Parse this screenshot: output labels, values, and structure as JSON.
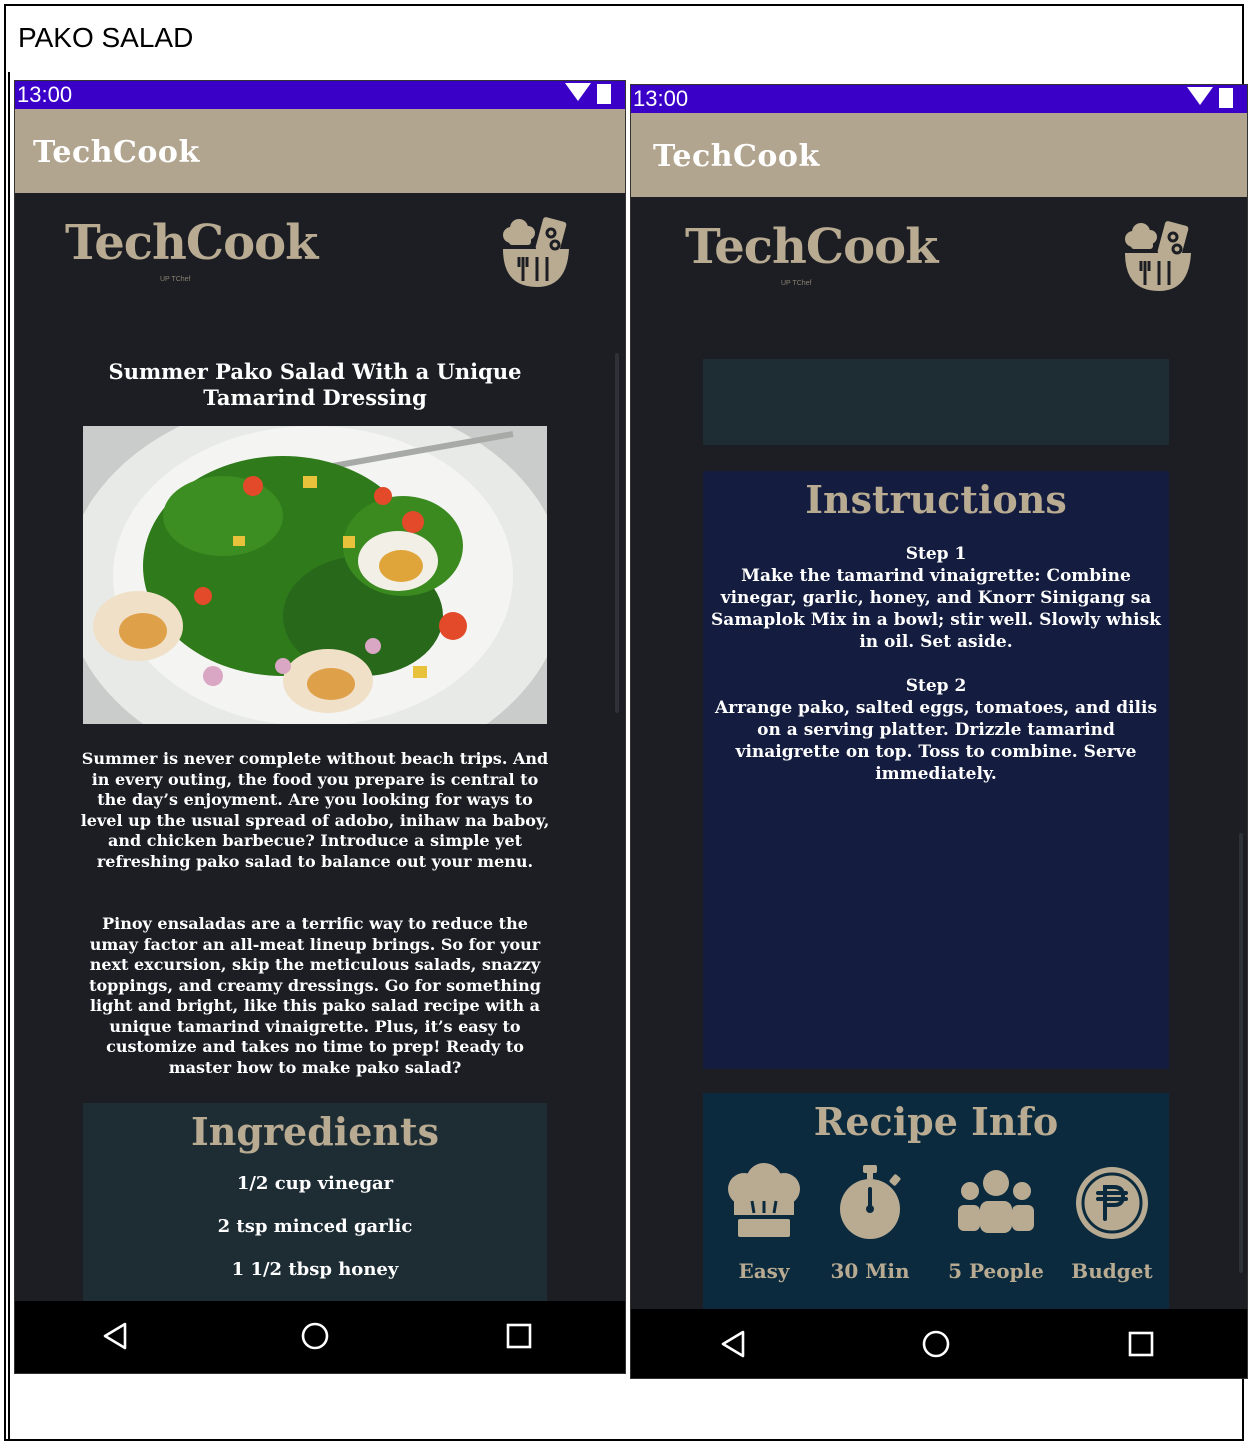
{
  "outer_title": "PAKO SALAD",
  "colors": {
    "status_bar": "#3b00c8",
    "app_bar": "#b2a58f",
    "background": "#1c1e24",
    "accent_tan": "#b8ab92",
    "ingredients_box": "#1e2c34",
    "instructions_box": "#141d3f",
    "info_box": "#0b2a3e"
  },
  "status_bar": {
    "time": "13:00",
    "icons": [
      "signal-icon",
      "battery-icon"
    ]
  },
  "app_bar": {
    "title": "TechCook"
  },
  "logo": {
    "text": "TechCook",
    "sub": "UP TChef",
    "icon": "chef-utensils-icon"
  },
  "screen1": {
    "recipe_title": "Summer Pako Salad With a Unique Tamarind Dressing",
    "description_1": "Summer is never complete without beach trips. And in every outing, the food you prepare is central to the day’s enjoyment. Are you looking for ways to level up the usual spread of adobo, inihaw na baboy, and chicken barbecue? Introduce a simple yet refreshing pako salad to balance out your menu.",
    "description_2": "Pinoy ensaladas are a terrific way to reduce the umay factor an all-meat lineup brings. So for your next excursion, skip the meticulous salads, snazzy toppings, and creamy dressings. Go for something light and bright, like this pako salad recipe with a unique tamarind vinaigrette. Plus, it’s easy to customize and takes no time to prep! Ready to master how to make pako salad?",
    "ingredients": {
      "heading": "Ingredients",
      "items": [
        "1/2 cup vinegar",
        "2 tsp minced garlic",
        "1 1/2 tbsp honey"
      ]
    }
  },
  "screen2": {
    "instructions": {
      "heading": "Instructions",
      "steps": [
        {
          "label": "Step 1",
          "text": "Make the tamarind vinaigrette: Combine vinegar, garlic, honey, and Knorr Sinigang sa Samaplok Mix in a bowl; stir well. Slowly whisk in oil. Set aside."
        },
        {
          "label": "Step 2",
          "text": "Arrange pako, salted eggs, tomatoes, and dilis on a serving platter. Drizzle tamarind vinaigrette on top. Toss to combine. Serve immediately."
        }
      ]
    },
    "recipe_info": {
      "heading": "Recipe Info",
      "items": [
        {
          "icon": "chef-hat-icon",
          "label": "Easy"
        },
        {
          "icon": "stopwatch-icon",
          "label": "30 Min"
        },
        {
          "icon": "people-icon",
          "label": "5 People"
        },
        {
          "icon": "peso-coin-icon",
          "label": "Budget"
        }
      ]
    }
  },
  "nav_bar": {
    "icons": [
      "back-icon",
      "home-icon",
      "recents-icon"
    ]
  }
}
